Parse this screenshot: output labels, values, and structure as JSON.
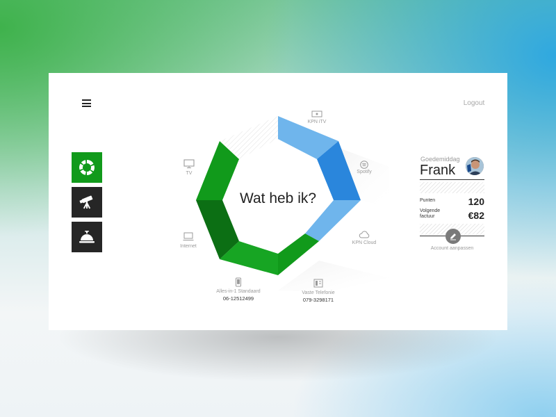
{
  "header": {
    "logout_label": "Logout"
  },
  "sidebar": {
    "items": [
      {
        "icon": "donut-chart-icon",
        "active": true
      },
      {
        "icon": "telescope-icon",
        "active": false
      },
      {
        "icon": "service-bell-icon",
        "active": false
      }
    ]
  },
  "wheel": {
    "title": "Wat heb ik?",
    "services": [
      {
        "label": "KPN iTV",
        "icon": "tv-box-icon",
        "number": ""
      },
      {
        "label": "Spotify",
        "icon": "spotify-icon",
        "number": ""
      },
      {
        "label": "KPN Cloud",
        "icon": "cloud-icon",
        "number": ""
      },
      {
        "label": "Vaste Telefonie",
        "icon": "landline-phone-icon",
        "number": "079-3298171"
      },
      {
        "label": "Alles-in-1 Standaard",
        "icon": "mobile-phone-icon",
        "number": "06-12512499"
      },
      {
        "label": "Internet",
        "icon": "laptop-icon",
        "number": ""
      },
      {
        "label": "TV",
        "icon": "monitor-icon",
        "number": ""
      }
    ],
    "colors": {
      "green": "#119a1b",
      "green_dark": "#0c6f14",
      "blue": "#6fb5ec",
      "blue_dark": "#2a86dc"
    }
  },
  "account": {
    "greeting": "Goedemiddag",
    "name": "Frank",
    "points_label": "Punten",
    "points_value": "120",
    "invoice_label_1": "Volgende",
    "invoice_label_2": "factuur",
    "invoice_value": "€82",
    "edit_link": "Account aanpassen"
  }
}
